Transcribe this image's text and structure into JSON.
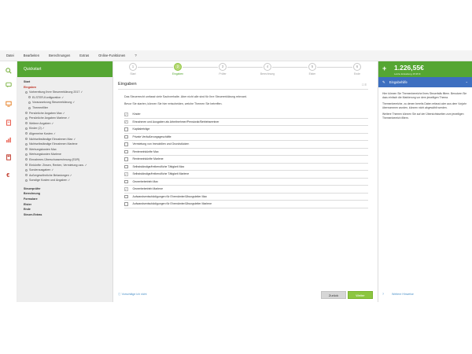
{
  "menu": [
    "Datei",
    "Bearbeiten",
    "Berechnungen",
    "Extras",
    "Online-Funktionen",
    "?"
  ],
  "rail_icons": [
    "search-icon",
    "chat-icon",
    "monitor-icon",
    "documents-icon",
    "chart-icon",
    "calculator-icon",
    "euro-icon"
  ],
  "sidebar": {
    "title": "Quickstart",
    "items": [
      {
        "label": "Start",
        "level": 0,
        "active": false,
        "check": false,
        "dot": false
      },
      {
        "label": "Eingaben",
        "level": 0,
        "active": true,
        "check": false,
        "dot": false
      },
      {
        "label": "Vorbereitung Ihrer Steuererklärung 2017 ✓",
        "level": 1,
        "active": false,
        "check": false,
        "dot": true
      },
      {
        "label": "ELSTER-Konfiguration ✓",
        "level": 2,
        "active": false,
        "check": false,
        "dot": true
      },
      {
        "label": "Voraussetzung Steuererklärung ✓",
        "level": 2,
        "active": false,
        "check": false,
        "dot": true
      },
      {
        "label": "Themenfilter",
        "level": 2,
        "active": false,
        "check": false,
        "dot": true
      },
      {
        "label": "Persönliche Angaben Max ✓",
        "level": 1,
        "active": false,
        "check": false,
        "dot": true
      },
      {
        "label": "Persönliche Angaben Marlene ✓",
        "level": 1,
        "active": false,
        "check": false,
        "dot": true
      },
      {
        "label": "Weitere Angaben ✓",
        "level": 1,
        "active": false,
        "check": false,
        "dot": true
      },
      {
        "label": "Kinder (2) ✓",
        "level": 1,
        "active": false,
        "check": false,
        "dot": true
      },
      {
        "label": "Allgemeine Kosten ✓",
        "level": 1,
        "active": false,
        "check": false,
        "dot": true
      },
      {
        "label": "Nichtselbständige Einnahmen Max ✓",
        "level": 1,
        "active": false,
        "check": false,
        "dot": true
      },
      {
        "label": "Nichtselbständige Einnahmen Marlene",
        "level": 1,
        "active": false,
        "check": false,
        "dot": true
      },
      {
        "label": "Werbungskosten Max",
        "level": 1,
        "active": false,
        "check": false,
        "dot": true
      },
      {
        "label": "Werbungskosten Marlene",
        "level": 1,
        "active": false,
        "check": false,
        "dot": true
      },
      {
        "label": "Einnahmen-Überschussrechnung (EÜR)",
        "level": 1,
        "active": false,
        "check": false,
        "dot": true
      },
      {
        "label": "Einkünfte: Zinsen, Renten, Vermietung usw. ✓",
        "level": 1,
        "active": false,
        "check": false,
        "dot": true
      },
      {
        "label": "Sonderausgaben ✓",
        "level": 1,
        "active": false,
        "check": false,
        "dot": true
      },
      {
        "label": "Außergewöhnliche Belastungen ✓",
        "level": 1,
        "active": false,
        "check": false,
        "dot": true
      },
      {
        "label": "Sonstige Kosten und Angaben ✓",
        "level": 1,
        "active": false,
        "check": false,
        "dot": true
      },
      {
        "label": "",
        "level": -1
      },
      {
        "label": "Steuerprüfer",
        "level": 0,
        "active": false,
        "check": false,
        "dot": false
      },
      {
        "label": "Berechnung",
        "level": 0,
        "active": false,
        "check": false,
        "dot": false
      },
      {
        "label": "Formulare",
        "level": 0,
        "active": false,
        "check": false,
        "dot": false
      },
      {
        "label": "Elster",
        "level": 0,
        "active": false,
        "check": false,
        "dot": false
      },
      {
        "label": "Ende",
        "level": 0,
        "active": false,
        "check": false,
        "dot": false
      },
      {
        "label": "Steuer-Extras",
        "level": 0,
        "active": false,
        "check": false,
        "dot": false
      }
    ]
  },
  "steps": [
    {
      "num": "1",
      "label": "Start",
      "active": false
    },
    {
      "num": "2",
      "label": "Eingaben",
      "active": true
    },
    {
      "num": "3",
      "label": "Prüfer",
      "active": false
    },
    {
      "num": "4",
      "label": "Berechnung",
      "active": false
    },
    {
      "num": "5",
      "label": "Elster",
      "active": false
    },
    {
      "num": "6",
      "label": "Ende",
      "active": false
    }
  ],
  "main": {
    "title": "Eingaben",
    "intro1": "Das Steuerrecht umfasst viele Sachverhalte. Aber nicht alle sind für Ihre Steuererklärung relevant.",
    "intro2": "Bevor Sie starten, können Sie hier entscheiden, welche Themen Sie betreffen.",
    "topics": [
      {
        "label": "Kinder",
        "checked": true
      },
      {
        "label": "Einnahmen und Ausgaben als Arbeitnehmer/Pensionär/Betriebsrentner",
        "checked": true
      },
      {
        "label": "Kapitalerträge",
        "checked": false
      },
      {
        "label": "Private Veräußerungsgeschäfte",
        "checked": false
      },
      {
        "label": "Vermietung von Immobilien und Grundstücken",
        "checked": false
      },
      {
        "label": "Renteneinkünfte Max",
        "checked": false
      },
      {
        "label": "Renteneinkünfte Marlene",
        "checked": false
      },
      {
        "label": "Selbstständige/freiberufliche Tätigkeit Max",
        "checked": false
      },
      {
        "label": "Selbstständige/freiberufliche Tätigkeit Marlene",
        "checked": true
      },
      {
        "label": "Gewerbebetrieb Max",
        "checked": false
      },
      {
        "label": "Gewerbebetrieb Marlene",
        "checked": true
      },
      {
        "label": "Aufwandsentschädigungen für Ehrenämter/Übungsleiter Max",
        "checked": false
      },
      {
        "label": "Aufwandsentschädigungen für Ehrenämter/Übungsleiter Marlene",
        "checked": false
      }
    ],
    "hint": "Vorschläge ich nicht",
    "back_label": "Zurück",
    "next_label": "Weiter"
  },
  "right": {
    "plus": "+",
    "amount": "1.226,55€",
    "amount_sub": "Letzte Erstattung 15:35 €",
    "help_title": "Eingabehilfe",
    "help_paragraphs": [
      "Hier können Sie Themenbereiche Ihres Steuerfalls filtern. Benutzen Sie dazu einfach die Markierung vor dem jeweiligen Thema.",
      "Themenbereiche, zu denen bereits Daten erfasst oder aus dem Vorjahr übernommen wurden, können nicht abgewählt werden.",
      "Weitere Themen können Sie auf der Übersichtsseiten zum jeweiligen Themenbereich filtern."
    ],
    "more_hints": "Weitere Hinweise"
  },
  "colors": {
    "accent_green": "#55a633",
    "button_green": "#8cc63f",
    "help_blue": "#3d6fc0",
    "active_red": "#c0392b"
  }
}
